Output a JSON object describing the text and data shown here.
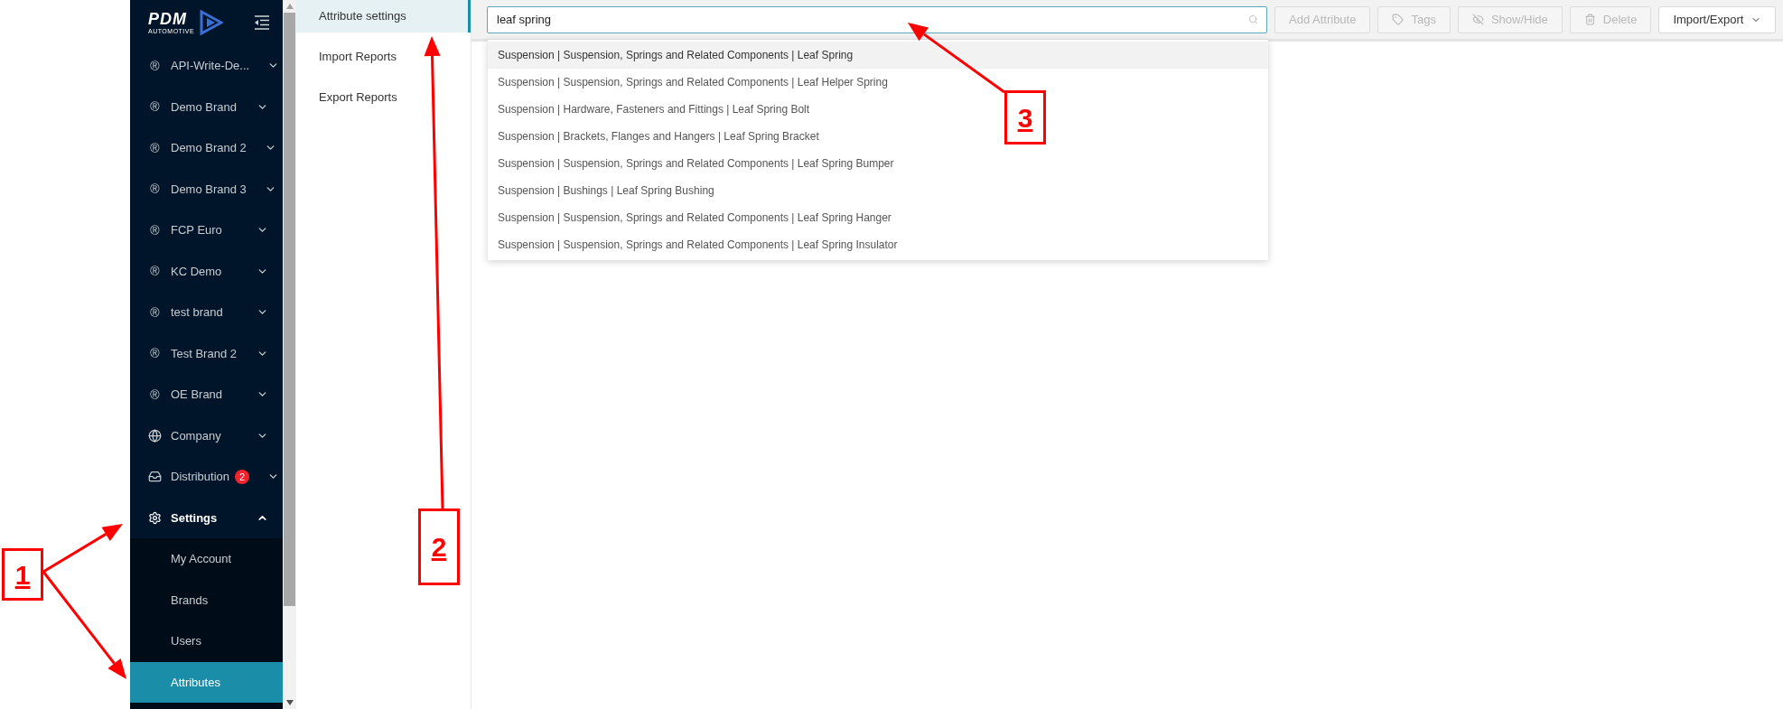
{
  "logo": {
    "name": "PDM",
    "tagline": "AUTOMOTIVE"
  },
  "sidebar": {
    "items": [
      {
        "kind": "brand",
        "icon": "®",
        "label": "API-Write-De...",
        "expanded": false
      },
      {
        "kind": "brand",
        "icon": "®",
        "label": "Demo Brand",
        "expanded": false
      },
      {
        "kind": "brand",
        "icon": "®",
        "label": "Demo Brand 2",
        "expanded": false
      },
      {
        "kind": "brand",
        "icon": "®",
        "label": "Demo Brand 3",
        "expanded": false
      },
      {
        "kind": "brand",
        "icon": "®",
        "label": "FCP Euro",
        "expanded": false
      },
      {
        "kind": "brand",
        "icon": "®",
        "label": "KC Demo",
        "expanded": false
      },
      {
        "kind": "brand",
        "icon": "®",
        "label": "test brand",
        "expanded": false
      },
      {
        "kind": "brand",
        "icon": "®",
        "label": "Test Brand 2",
        "expanded": false
      },
      {
        "kind": "brand",
        "icon": "®",
        "label": "OE Brand",
        "expanded": false
      },
      {
        "kind": "company",
        "label": "Company",
        "expanded": false
      },
      {
        "kind": "distribution",
        "label": "Distribution",
        "badge": "2",
        "expanded": false
      },
      {
        "kind": "settings",
        "label": "Settings",
        "expanded": true,
        "children": [
          {
            "label": "My Account",
            "selected": false
          },
          {
            "label": "Brands",
            "selected": false
          },
          {
            "label": "Users",
            "selected": false
          },
          {
            "label": "Attributes",
            "selected": true
          }
        ]
      }
    ]
  },
  "submenu": [
    {
      "label": "Attribute settings",
      "selected": true
    },
    {
      "label": "Import Reports",
      "selected": false
    },
    {
      "label": "Export Reports",
      "selected": false
    }
  ],
  "search": {
    "value": "leaf spring"
  },
  "suggestions": [
    {
      "text": "Suspension | Suspension, Springs and Related Components | Leaf Spring",
      "selected": true
    },
    {
      "text": "Suspension | Suspension, Springs and Related Components | Leaf Helper Spring",
      "selected": false
    },
    {
      "text": "Suspension | Hardware, Fasteners and Fittings | Leaf Spring Bolt",
      "selected": false
    },
    {
      "text": "Suspension | Brackets, Flanges and Hangers | Leaf Spring Bracket",
      "selected": false
    },
    {
      "text": "Suspension | Suspension, Springs and Related Components | Leaf Spring Bumper",
      "selected": false
    },
    {
      "text": "Suspension | Bushings | Leaf Spring Bushing",
      "selected": false
    },
    {
      "text": "Suspension | Suspension, Springs and Related Components | Leaf Spring Hanger",
      "selected": false
    },
    {
      "text": "Suspension | Suspension, Springs and Related Components | Leaf Spring Insulator",
      "selected": false
    }
  ],
  "toolbar": [
    {
      "kind": "add",
      "label": "Add Attribute",
      "disabled": true
    },
    {
      "kind": "tags",
      "label": "Tags",
      "disabled": true
    },
    {
      "kind": "showhide",
      "label": "Show/Hide",
      "disabled": true
    },
    {
      "kind": "delete",
      "label": "Delete",
      "disabled": true
    },
    {
      "kind": "menu",
      "label": "Import/Export",
      "disabled": false
    }
  ],
  "annotations": [
    {
      "label": "1"
    },
    {
      "label": "2"
    },
    {
      "label": "3"
    }
  ]
}
